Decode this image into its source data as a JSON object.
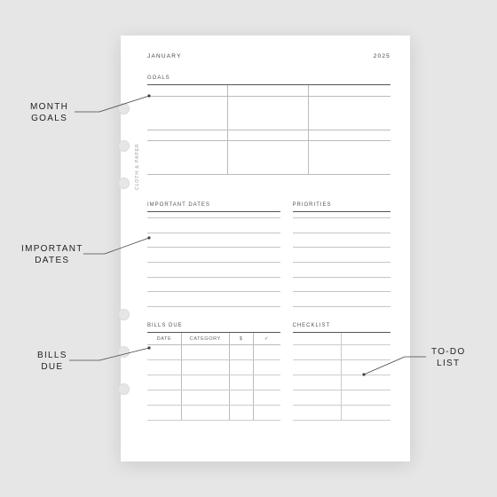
{
  "header": {
    "month": "JANUARY",
    "year": "2025"
  },
  "sections": {
    "goals": "GOALS",
    "important_dates": "IMPORTANT DATES",
    "priorities": "PRIORITIES",
    "bills_due": "BILLS DUE",
    "checklist": "CHECKLIST"
  },
  "bills_columns": {
    "date": "DATE",
    "category": "CATEGORY",
    "amount": "$",
    "check": "✓"
  },
  "brand": "CLOTH & PAPER",
  "callouts": {
    "month_goals": "MONTH\nGOALS",
    "important_dates": "IMPORTANT\nDATES",
    "bills_due": "BILLS\nDUE",
    "todo": "TO-DO\nLIST"
  }
}
